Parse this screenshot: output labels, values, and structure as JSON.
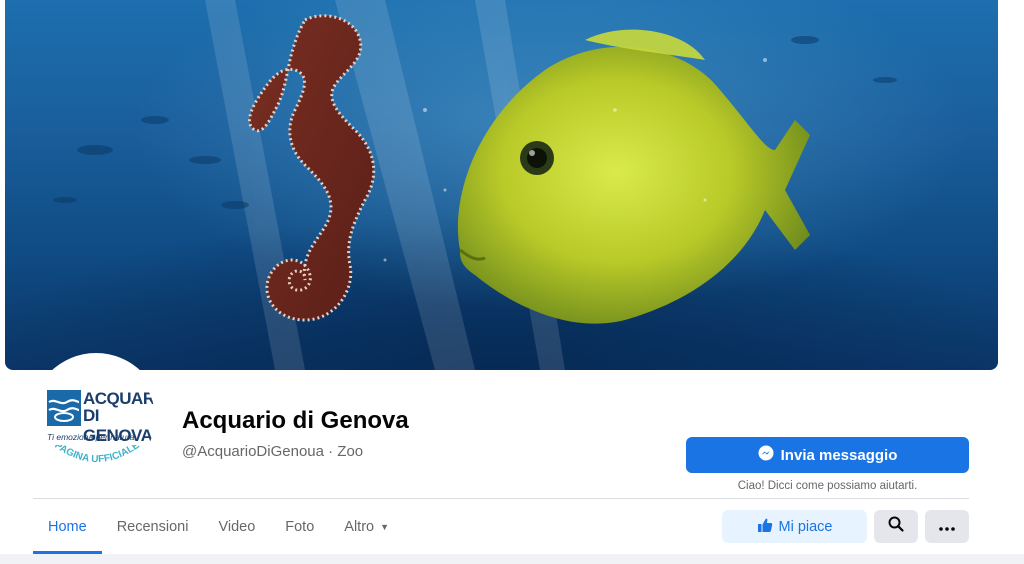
{
  "cover": {
    "alt_icon": "cover-photo-seahorse-and-tang-fish"
  },
  "profile": {
    "logo": {
      "line1": "ACQUARIO",
      "line2": "DI GENOVA",
      "tagline": "Ti emoziona per natura.",
      "badge": "PAGINA UFFICIALE"
    },
    "name": "Acquario di Genova",
    "meta": "@AcquarioDiGenoua · Zoo"
  },
  "actions": {
    "message_label": "Invia messaggio",
    "message_sub": "Ciao! Dicci come possiamo aiutarti.",
    "like_label": "Mi piace"
  },
  "tabs": [
    {
      "label": "Home",
      "active": true
    },
    {
      "label": "Recensioni"
    },
    {
      "label": "Video"
    },
    {
      "label": "Foto"
    },
    {
      "label": "Altro"
    }
  ],
  "colors": {
    "accent": "#1b74e4",
    "like_bg": "#e7f3ff",
    "icon_btn_bg": "#e4e6eb",
    "secondary_text": "#65676b"
  }
}
